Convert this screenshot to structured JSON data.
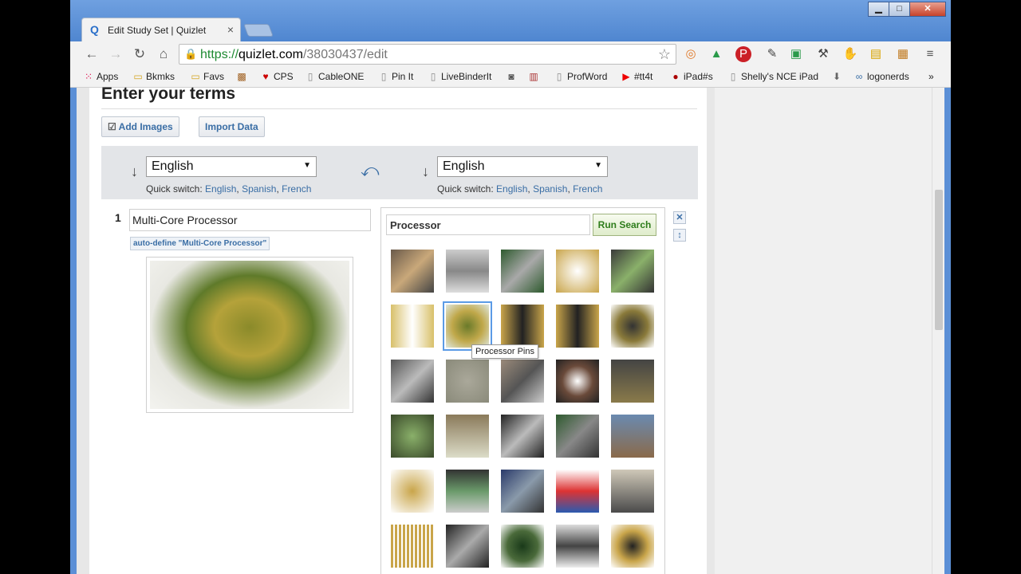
{
  "window": {
    "minimize_glyph": "▁",
    "maximize_glyph": "□",
    "close_glyph": "✕"
  },
  "tab": {
    "title": "Edit Study Set | Quizlet",
    "favicon_letter": "Q",
    "close_glyph": "×"
  },
  "address_bar": {
    "scheme": "https://",
    "host": "quizlet.com",
    "path": "/38030437/edit"
  },
  "bookmarks": [
    {
      "label": "Apps",
      "icon": "apps-grid-icon"
    },
    {
      "label": "Bkmks",
      "icon": "folder-icon"
    },
    {
      "label": "Favs",
      "icon": "folder-icon"
    },
    {
      "label": "",
      "icon": "bookmark-image-icon"
    },
    {
      "label": "CPS",
      "icon": "heart-icon"
    },
    {
      "label": "CableONE",
      "icon": "page-icon"
    },
    {
      "label": "Pin It",
      "icon": "page-icon"
    },
    {
      "label": "LiveBinderIt",
      "icon": "page-icon"
    },
    {
      "label": "",
      "icon": "camera-icon"
    },
    {
      "label": "",
      "icon": "books-icon"
    },
    {
      "label": "ProfWord",
      "icon": "page-icon"
    },
    {
      "label": "#tt4t",
      "icon": "youtube-icon"
    },
    {
      "label": "iPad#s",
      "icon": "apple-icon"
    },
    {
      "label": "Shelly's NCE iPad",
      "icon": "page-icon"
    },
    {
      "label": "",
      "icon": "download-icon"
    },
    {
      "label": "logonerds",
      "icon": "glasses-icon"
    }
  ],
  "bookmarks_more": "»",
  "page": {
    "heading": "Enter your terms",
    "add_images_label": "Add Images",
    "import_data_label": "Import Data",
    "left_language": "English",
    "right_language": "English",
    "quick_switch_label": "Quick switch:",
    "quick_switch_options": [
      "English",
      "Spanish",
      "French"
    ],
    "row_number": "1",
    "term_value": "Multi-Core Processor",
    "auto_define_label": "auto-define \"Multi-Core Processor\"",
    "image_search_query": "Processor",
    "run_search_label": "Run Search",
    "tooltip": "Processor Pins",
    "colors": {
      "link": "#3a6ea5",
      "run_search_text": "#2f7d1c",
      "selected_outline": "#5b9be6"
    }
  }
}
